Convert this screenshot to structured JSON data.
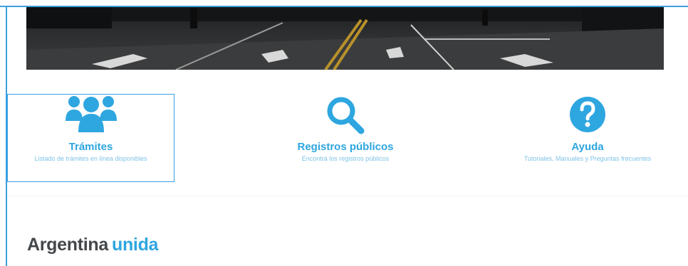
{
  "colors": {
    "accent": "#2ea6e0",
    "accent_light": "#7fc3e8",
    "text_dark": "#44474a",
    "frame": "#3aa0e0"
  },
  "nav": {
    "items": [
      {
        "title": "Trámites",
        "subtitle": "Listado de trámites en línea disponibles",
        "icon": "users-group-icon"
      },
      {
        "title": "Registros públicos",
        "subtitle": "Encontrá los registros públicos",
        "icon": "search-icon"
      },
      {
        "title": "Ayuda",
        "subtitle": "Tutoriales, Manuales y Preguntas frecuentes",
        "icon": "question-icon"
      }
    ]
  },
  "brand": {
    "word1": "Argentina",
    "word2": "unida"
  }
}
